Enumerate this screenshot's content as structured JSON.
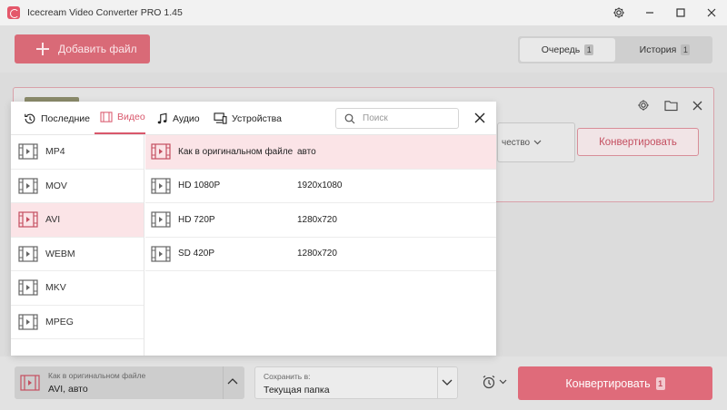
{
  "titlebar": {
    "title": "Icecream Video Converter PRO 1.45"
  },
  "toolbar": {
    "add_file_label": "Добавить файл",
    "tabs": [
      {
        "label": "Очередь",
        "count": "1"
      },
      {
        "label": "История",
        "count": "1"
      }
    ]
  },
  "card": {
    "quality_label": "чество",
    "convert_label": "Конвертировать"
  },
  "popover": {
    "tabs": [
      {
        "label": "Последние",
        "icon": "history-icon"
      },
      {
        "label": "Видео",
        "icon": "film-icon"
      },
      {
        "label": "Аудио",
        "icon": "music-note-icon"
      },
      {
        "label": "Устройства",
        "icon": "devices-icon"
      }
    ],
    "active_tab": "Видео",
    "search_placeholder": "Поиск",
    "formats": [
      "MP4",
      "MOV",
      "AVI",
      "WEBM",
      "MKV",
      "MPEG"
    ],
    "selected_format": "AVI",
    "presets": [
      {
        "name": "Как в оригинальном файле",
        "resolution": "авто"
      },
      {
        "name": "HD 1080P",
        "resolution": "1920x1080"
      },
      {
        "name": "HD 720P",
        "resolution": "1280x720"
      },
      {
        "name": "SD 420P",
        "resolution": "1280x720"
      }
    ],
    "selected_preset": "Как в оригинальном файле"
  },
  "bottom": {
    "format_small": "Как в оригинальном файле",
    "format_value": "AVI, авто",
    "save_small": "Сохранить в:",
    "save_value": "Текущая папка",
    "convert_label": "Конвертировать",
    "convert_count": "1"
  },
  "colors": {
    "accent": "#df6b7a",
    "selected_bg": "#fbe4e7"
  }
}
